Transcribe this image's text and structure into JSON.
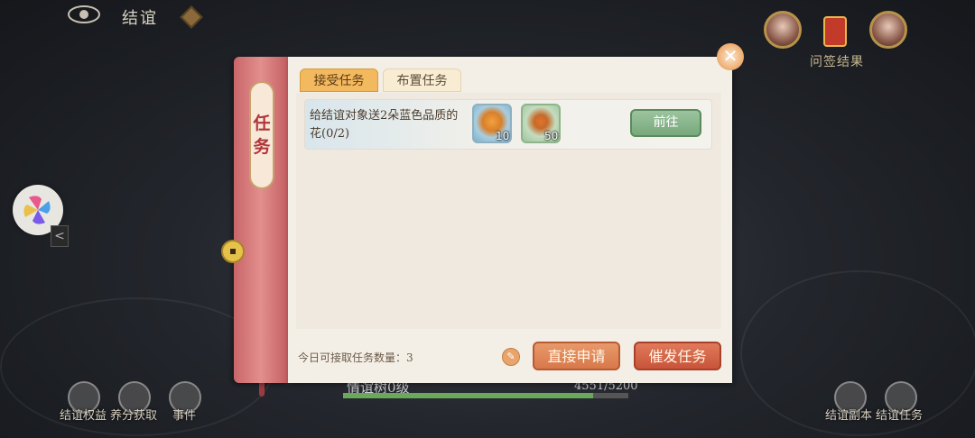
{
  "topbar": {
    "title": "结谊"
  },
  "header_right": {
    "wenqian_label": "问签结果"
  },
  "panel": {
    "spine_title": "任务",
    "tabs": [
      {
        "label": "接受任务",
        "active": true
      },
      {
        "label": "布置任务",
        "active": false
      }
    ],
    "tasks": [
      {
        "description": "给结谊对象送2朵蓝色品质的花(0/2)",
        "rewards": [
          {
            "icon": "oranges-plate-icon",
            "count": "10"
          },
          {
            "icon": "sprout-icon",
            "count": "50"
          }
        ],
        "go_label": "前往"
      }
    ],
    "quota_text": "今日可接取任务数量：3",
    "apply_label": "直接申请",
    "publish_label": "催发任务"
  },
  "bottom_bar": {
    "items": [
      {
        "label": "结谊权益",
        "icon": "rights-icon"
      },
      {
        "label": "养分获取",
        "icon": "nutrient-icon"
      },
      {
        "label": "事件",
        "icon": "event-icon"
      },
      {
        "label": "结谊副本",
        "icon": "dungeon-icon"
      },
      {
        "label": "结谊任务",
        "icon": "task-icon"
      }
    ],
    "level_text": "情谊树0级",
    "xp_text": "4551/5200",
    "xp_fraction": 0.875
  },
  "colors": {
    "accent": "#f3b95e",
    "spine": "#e28f8d",
    "go_button": "#78a87c",
    "publish_button": "#c8543a"
  }
}
